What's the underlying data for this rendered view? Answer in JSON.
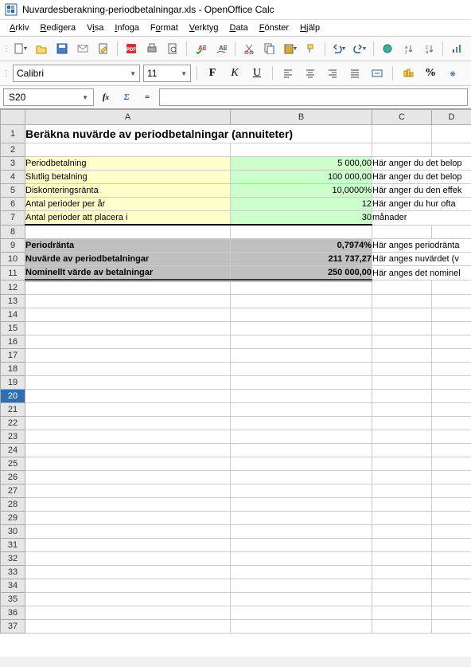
{
  "window": {
    "title": "Nuvardesberakning-periodbetalningar.xls - OpenOffice Calc"
  },
  "menu": {
    "arkiv": "Arkiv",
    "redigera": "Redigera",
    "visa": "Visa",
    "infoga": "Infoga",
    "format": "Format",
    "verktyg": "Verktyg",
    "data": "Data",
    "fonster": "Fönster",
    "hjalp": "Hjälp"
  },
  "font": {
    "name": "Calibri",
    "size": "11"
  },
  "cellref": "S20",
  "formula": "",
  "columns": {
    "A": "A",
    "B": "B",
    "C": "C",
    "D": "D"
  },
  "rows": {
    "r1": {
      "A": "Beräkna nuvärde av periodbetalningar (annuiteter)"
    },
    "r3": {
      "A": "Periodbetalning",
      "B": "5 000,00",
      "C": "Här anger du det belop"
    },
    "r4": {
      "A": "Slutlig betalning",
      "B": "100 000,00",
      "C": "Här anger du det belop"
    },
    "r5": {
      "A": "Diskonteringsränta",
      "B": "10,0000%",
      "C": "Här anger du den effek"
    },
    "r6": {
      "A": "Antal perioder per år",
      "B": "12",
      "C": "Här anger du hur ofta"
    },
    "r7": {
      "A": "Antal perioder att placera i",
      "B": "30",
      "C": "månader"
    },
    "r9": {
      "A": "Periodränta",
      "B": "0,7974%",
      "C": "Här anges periodränta"
    },
    "r10": {
      "A": "Nuvärde av periodbetalningar",
      "B": "211 737,27",
      "C": "Här anges nuvärdet (v"
    },
    "r11": {
      "A": "Nominellt värde av betalningar",
      "B": "250 000,00",
      "C": "Här anges det nominel"
    }
  }
}
